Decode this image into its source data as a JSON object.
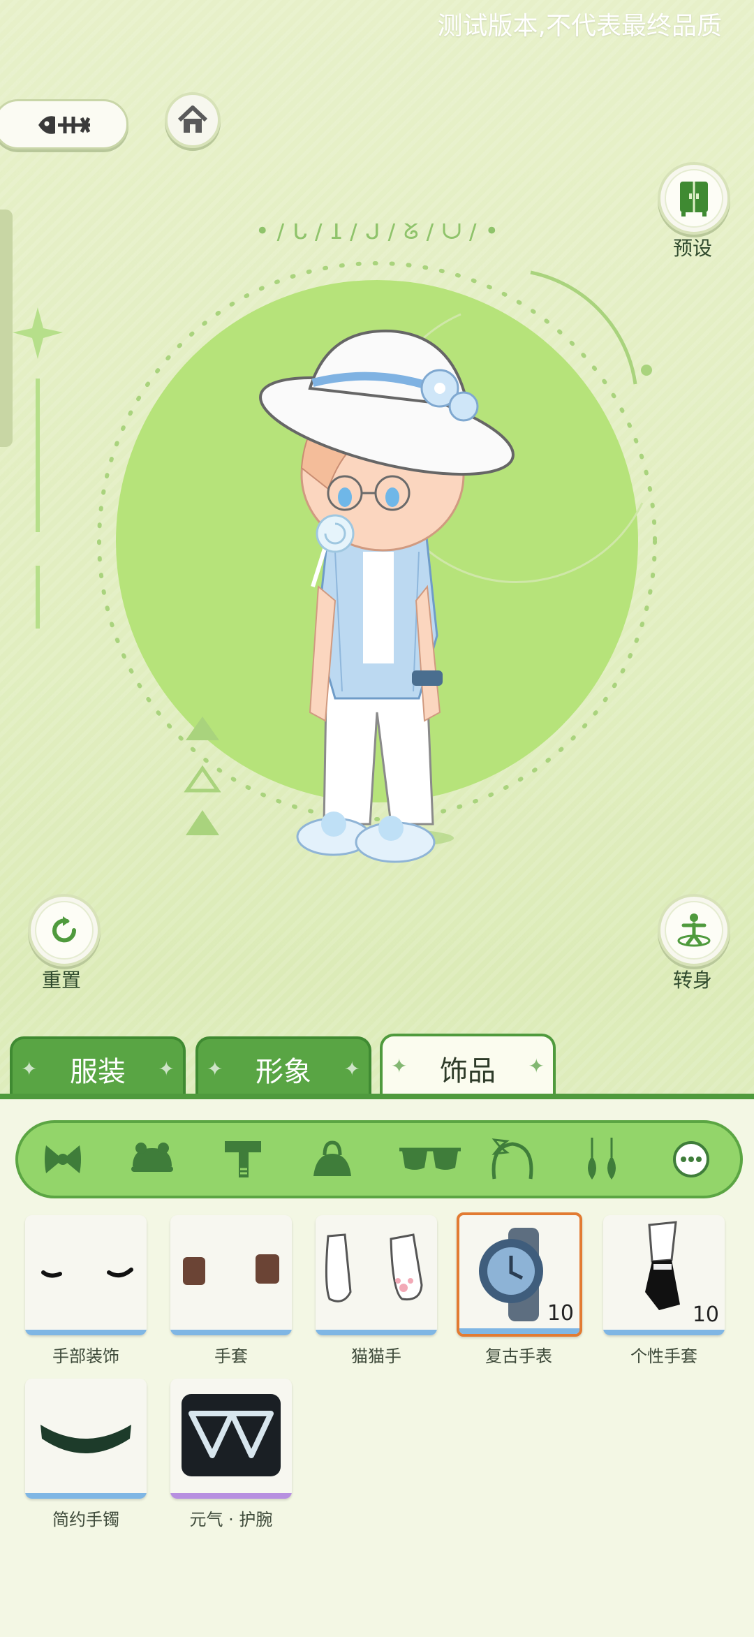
{
  "watermark": "测试版本,不代表最终品质",
  "top_buttons": {
    "preset_label": "预设",
    "reset_label": "重置",
    "turn_label": "转身"
  },
  "tabs": [
    {
      "label": "服装",
      "active": false
    },
    {
      "label": "形象",
      "active": false
    },
    {
      "label": "饰品",
      "active": true
    }
  ],
  "categories": [
    "bow-icon",
    "frog-hat-icon",
    "scarf-icon",
    "handbag-icon",
    "sunglasses-icon",
    "headband-icon",
    "earrings-icon",
    "more-icon"
  ],
  "items": [
    {
      "label": "手部装饰",
      "badge": "",
      "selected": false
    },
    {
      "label": "手套",
      "badge": "",
      "selected": false
    },
    {
      "label": "猫猫手",
      "badge": "",
      "selected": false
    },
    {
      "label": "复古手表",
      "badge": "10",
      "selected": true
    },
    {
      "label": "个性手套",
      "badge": "10",
      "selected": false
    },
    {
      "label": "简约手镯",
      "badge": "",
      "selected": false
    },
    {
      "label": "元气 · 护腕",
      "badge": "",
      "selected": false
    }
  ],
  "colors": {
    "accent_green": "#59a544",
    "selected_border": "#e27b32",
    "circle_green": "#b6e37a"
  }
}
